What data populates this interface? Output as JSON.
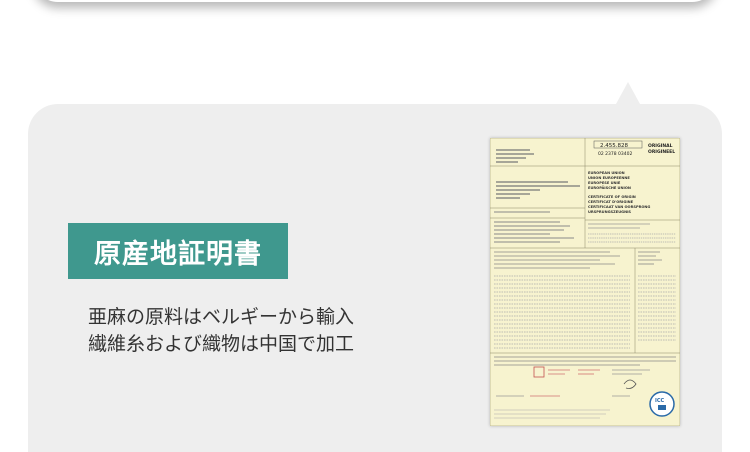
{
  "badge": {
    "label": "原産地証明書"
  },
  "description": {
    "line1": "亜麻の原料はベルギーから輸入",
    "line2": "繊維糸および織物は中国で加工"
  },
  "certificate": {
    "number": "2.455.828",
    "ref": "02 2378 03402",
    "header_lines": [
      "ORIGINAL",
      "ORIGINEEL"
    ],
    "union_lines": [
      "EUROPEAN UNION",
      "UNION EUROPEENNE",
      "EUROPESE UNIE",
      "EUROPÄISCHE UNION"
    ],
    "title_lines": [
      "CERTIFICATE OF ORIGIN",
      "CERTIFICAT D'ORIGINE",
      "CERTIFICAAT VAN OORSPRONG",
      "URSPRUNGSZEUGNIS"
    ],
    "paper_color": "#f7f3cf",
    "logo_text": "ICC"
  },
  "colors": {
    "badge_bg": "#3f988e",
    "bubble_bg": "#eeeeee",
    "text": "#333333"
  }
}
